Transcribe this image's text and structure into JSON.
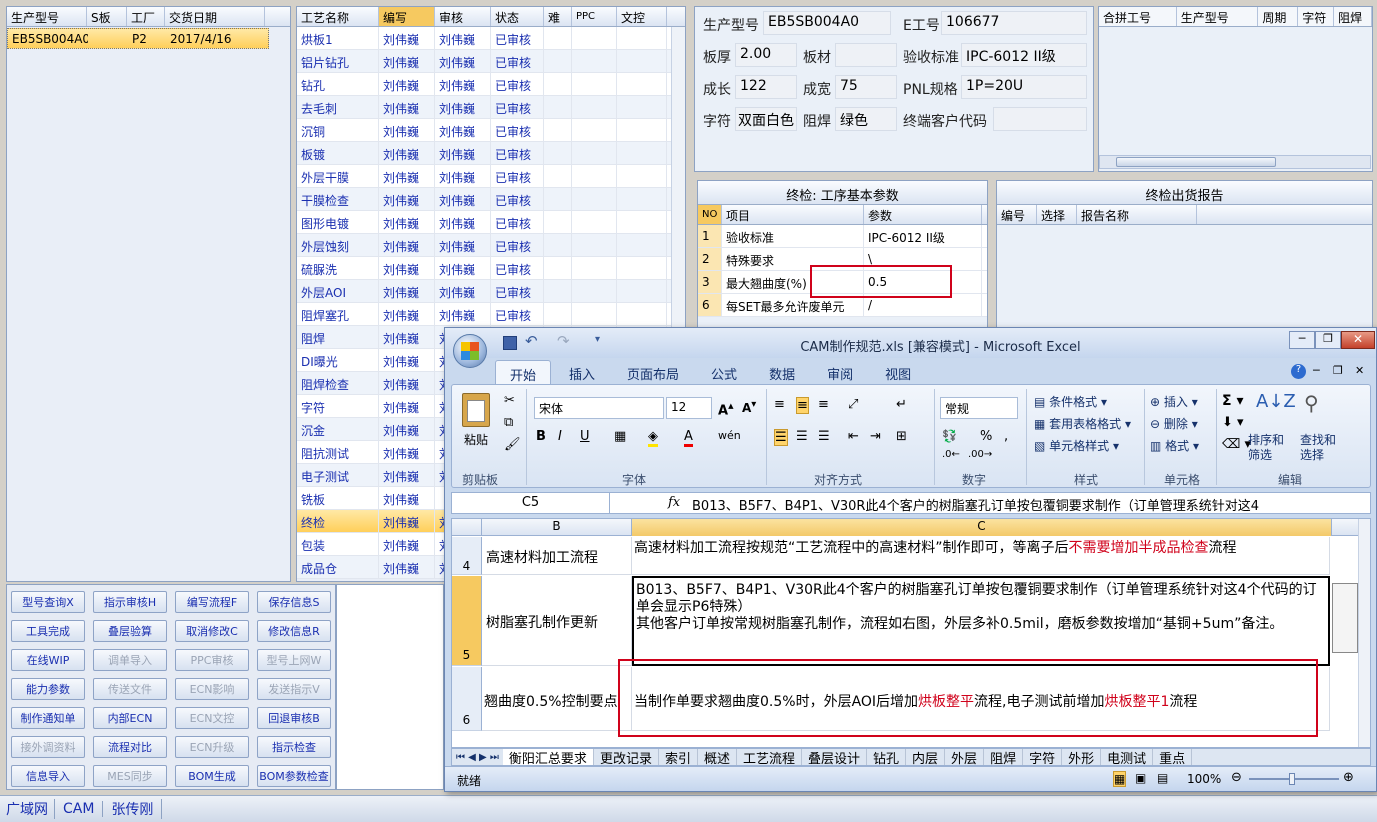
{
  "left_grid": {
    "headers": [
      "生产型号",
      "S板",
      "工厂",
      "交货日期"
    ],
    "row": {
      "model": "EB5SB004A0",
      "s": "",
      "factory": "P2",
      "date": "2017/4/16"
    }
  },
  "process_grid": {
    "headers": [
      "工艺名称",
      "编写",
      "审核",
      "状态",
      "难",
      "PPC",
      "文控"
    ],
    "rows": [
      {
        "name": "烘板1",
        "author": "刘伟巍",
        "reviewer": "刘伟巍",
        "status": "已审核"
      },
      {
        "name": "铝片钻孔",
        "author": "刘伟巍",
        "reviewer": "刘伟巍",
        "status": "已审核"
      },
      {
        "name": "钻孔",
        "author": "刘伟巍",
        "reviewer": "刘伟巍",
        "status": "已审核"
      },
      {
        "name": "去毛刺",
        "author": "刘伟巍",
        "reviewer": "刘伟巍",
        "status": "已审核"
      },
      {
        "name": "沉铜",
        "author": "刘伟巍",
        "reviewer": "刘伟巍",
        "status": "已审核"
      },
      {
        "name": "板镀",
        "author": "刘伟巍",
        "reviewer": "刘伟巍",
        "status": "已审核"
      },
      {
        "name": "外层干膜",
        "author": "刘伟巍",
        "reviewer": "刘伟巍",
        "status": "已审核"
      },
      {
        "name": "干膜检查",
        "author": "刘伟巍",
        "reviewer": "刘伟巍",
        "status": "已审核"
      },
      {
        "name": "图形电镀",
        "author": "刘伟巍",
        "reviewer": "刘伟巍",
        "status": "已审核"
      },
      {
        "name": "外层蚀刻",
        "author": "刘伟巍",
        "reviewer": "刘伟巍",
        "status": "已审核"
      },
      {
        "name": "硫脲洗",
        "author": "刘伟巍",
        "reviewer": "刘伟巍",
        "status": "已审核"
      },
      {
        "name": "外层AOI",
        "author": "刘伟巍",
        "reviewer": "刘伟巍",
        "status": "已审核"
      },
      {
        "name": "阻焊塞孔",
        "author": "刘伟巍",
        "reviewer": "刘伟巍",
        "status": "已审核"
      },
      {
        "name": "阻焊",
        "author": "刘伟巍",
        "reviewer": "刘",
        "status": ""
      },
      {
        "name": "DI曝光",
        "author": "刘伟巍",
        "reviewer": "刘",
        "status": ""
      },
      {
        "name": "阻焊检查",
        "author": "刘伟巍",
        "reviewer": "刘",
        "status": ""
      },
      {
        "name": "字符",
        "author": "刘伟巍",
        "reviewer": "刘",
        "status": ""
      },
      {
        "name": "沉金",
        "author": "刘伟巍",
        "reviewer": "刘",
        "status": ""
      },
      {
        "name": "阻抗测试",
        "author": "刘伟巍",
        "reviewer": "刘",
        "status": ""
      },
      {
        "name": "电子测试",
        "author": "刘伟巍",
        "reviewer": "刘",
        "status": ""
      },
      {
        "name": "铣板",
        "author": "刘伟巍",
        "reviewer": "",
        "status": ""
      },
      {
        "name": "终检",
        "author": "刘伟巍",
        "reviewer": "刘",
        "status": ""
      },
      {
        "name": "包装",
        "author": "刘伟巍",
        "reviewer": "刘",
        "status": ""
      },
      {
        "name": "成品仓",
        "author": "刘伟巍",
        "reviewer": "刘",
        "status": ""
      }
    ]
  },
  "buttons": [
    [
      "型号查询X",
      "指示审核H",
      "编写流程F",
      "保存信息S"
    ],
    [
      "工具完成",
      "叠层验算",
      "取消修改C",
      "修改信息R"
    ],
    [
      "在线WIP",
      "调单导入",
      "PPC审核",
      "型号上网W"
    ],
    [
      "能力参数",
      "传送文件",
      "ECN影响",
      "发送指示V"
    ],
    [
      "制作通知单",
      "内部ECN",
      "ECN文控",
      "回退审核B"
    ],
    [
      "接外调资料",
      "流程对比",
      "ECN升级",
      "指示检查"
    ],
    [
      "信息导入",
      "MES同步",
      "BOM生成",
      "BOM参数检查"
    ]
  ],
  "info": {
    "model_label": "生产型号",
    "model": "EB5SB004A0",
    "eno_label": "E工号",
    "eno": "106677",
    "thick_label": "板厚",
    "thick": "2.00",
    "mat_label": "板材",
    "mat": "",
    "std_label": "验收标准",
    "std": "IPC-6012 II级",
    "len_label": "成长",
    "len": "122",
    "wid_label": "成宽",
    "wid": "75",
    "pnl_label": "PNL规格",
    "pnl": "1P=20U",
    "char_label": "字符",
    "char": "双面白色",
    "mask_label": "阻焊",
    "mask": "绿色",
    "cust_label": "终端客户代码",
    "cust": ""
  },
  "merge_grid": {
    "headers": [
      "合拼工号",
      "生产型号",
      "周期",
      "字符",
      "阻焊"
    ]
  },
  "params_panel": {
    "title": "终检: 工序基本参数",
    "headers": [
      "NO",
      "项目",
      "参数"
    ],
    "rows": [
      {
        "no": "1",
        "item": "验收标准",
        "val": "IPC-6012 II级"
      },
      {
        "no": "2",
        "item": "特殊要求",
        "val": "\\"
      },
      {
        "no": "3",
        "item": "最大翘曲度(%)",
        "val": "0.5"
      },
      {
        "no": "6",
        "item": "每SET最多允许废单元",
        "val": "/"
      }
    ]
  },
  "report_panel": {
    "title": "终检出货报告",
    "headers": [
      "编号",
      "选择",
      "报告名称"
    ]
  },
  "status_bar": [
    "广域网",
    "CAM",
    "张传刚"
  ],
  "excel": {
    "title": "CAM制作规范.xls [兼容模式] - Microsoft Excel",
    "tabs": [
      "开始",
      "插入",
      "页面布局",
      "公式",
      "数据",
      "审阅",
      "视图"
    ],
    "font_name": "宋体",
    "font_size": "12",
    "number_format": "常规",
    "groups": [
      "剪贴板",
      "字体",
      "对齐方式",
      "数字",
      "样式",
      "单元格",
      "编辑"
    ],
    "paste": "粘贴",
    "style_btns": [
      "条件格式",
      "套用表格格式",
      "单元格样式"
    ],
    "cell_btns": [
      "插入",
      "删除",
      "格式"
    ],
    "edit_btns": [
      "排序和筛选",
      "查找和选择"
    ],
    "name_box": "C5",
    "formula": "B013、B5F7、B4P1、V30R此4个客户的树脂塞孔订单按包覆铜要求制作（订单管理系统针对这4",
    "col_b": "B",
    "col_c": "C",
    "rows": [
      {
        "num": "4",
        "b": "高速材料加工流程",
        "c1": "高速材料加工流程按规范“工艺流程中的高速材料”制作即可，等离子后",
        "c_red": "不需要增加半成品检查",
        "c2": "流程"
      },
      {
        "num": "5",
        "b": "树脂塞孔制作更新",
        "c": "B013、B5F7、B4P1、V30R此4个客户的树脂塞孔订单按包覆铜要求制作（订单管理系统针对这4个代码的订单会显示P6特殊）\n其他客户订单按常规树脂塞孔制作，流程如右图，外层多补0.5mil，磨板参数按增加“基铜+5um”备注。"
      },
      {
        "num": "6",
        "b": "翘曲度0.5%控制要点",
        "c1": "当制作单要求翘曲度0.5%时，外层AOI后增加",
        "c_red1": "烘板整平",
        "c2": "流程,电子测试前增加",
        "c_red2": "烘板整平1",
        "c3": "流程"
      }
    ],
    "sheets": [
      "衡阳汇总要求",
      "更改记录",
      "索引",
      "概述",
      "工艺流程",
      "叠层设计",
      "钻孔",
      "内层",
      "外层",
      "阻焊",
      "字符",
      "外形",
      "电测试",
      "重点"
    ],
    "status": "就绪",
    "zoom": "100%"
  },
  "colors": {
    "accent": "#1a2fb0",
    "red": "#d0021b",
    "highlight": "#ffd24d"
  }
}
